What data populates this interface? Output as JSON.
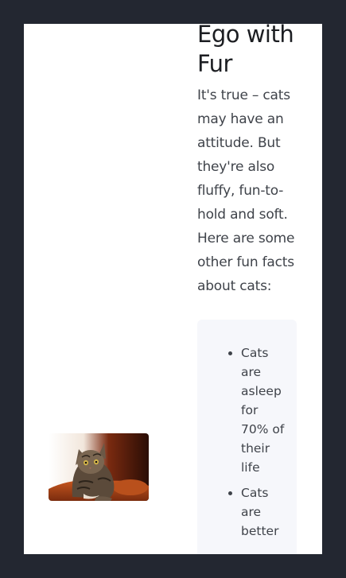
{
  "article": {
    "title": "Ego with Fur",
    "intro": "It's true – cats may have an attitude. But they're also fluffy, fun-to-hold and soft. Here are some other fun facts about cats:",
    "image": {
      "subject": "tabby-cat-photo"
    },
    "facts": [
      "Cats are asleep for 70% of their life",
      "Cats are better"
    ]
  },
  "colors": {
    "page_background": "#232731",
    "card_background": "#ffffff",
    "facts_box_background": "#f6f7fb",
    "heading_text": "#1c1e22",
    "body_text": "#3f434a"
  }
}
